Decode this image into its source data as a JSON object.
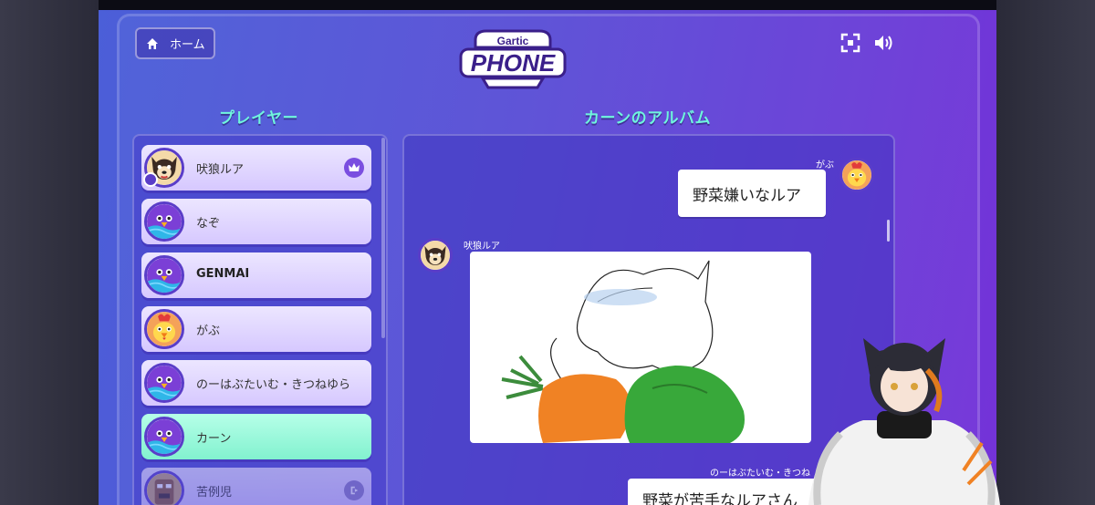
{
  "header": {
    "home_label": "ホーム",
    "logo_top": "Gartic",
    "logo_main": "PHONE"
  },
  "sections": {
    "players_title": "プレイヤー",
    "album_title": "カーンのアルバム"
  },
  "players": [
    {
      "name": "吠狼ルア",
      "avatar": "dog-avatar-icon",
      "host": true,
      "crown": true
    },
    {
      "name": "なぞ",
      "avatar": "bird-avatar-icon"
    },
    {
      "name": "GENMAI",
      "avatar": "bird-avatar-icon",
      "bold": true
    },
    {
      "name": "がぶ",
      "avatar": "rooster-avatar-icon"
    },
    {
      "name": "のーはぶたいむ・きつねゆら",
      "avatar": "bird-avatar-icon"
    },
    {
      "name": "カーン",
      "avatar": "bird-avatar-icon",
      "active": true
    },
    {
      "name": "苦例児",
      "avatar": "tiki-avatar-icon",
      "faded": true
    }
  ],
  "album": {
    "messages": [
      {
        "author": "がぶ",
        "text": "野菜嫌いなルア",
        "side": "right"
      },
      {
        "author": "吠狼ルア",
        "type": "drawing",
        "side": "left"
      },
      {
        "author": "のーはぶたいむ・きつね",
        "text": "野菜が苦手なルアさん",
        "side": "right"
      }
    ]
  },
  "colors": {
    "accent_title": "#6ff5dd",
    "player_card": "#e2d8ff",
    "active_card": "#96f5d8",
    "avatar_border": "#5a3dc8"
  }
}
